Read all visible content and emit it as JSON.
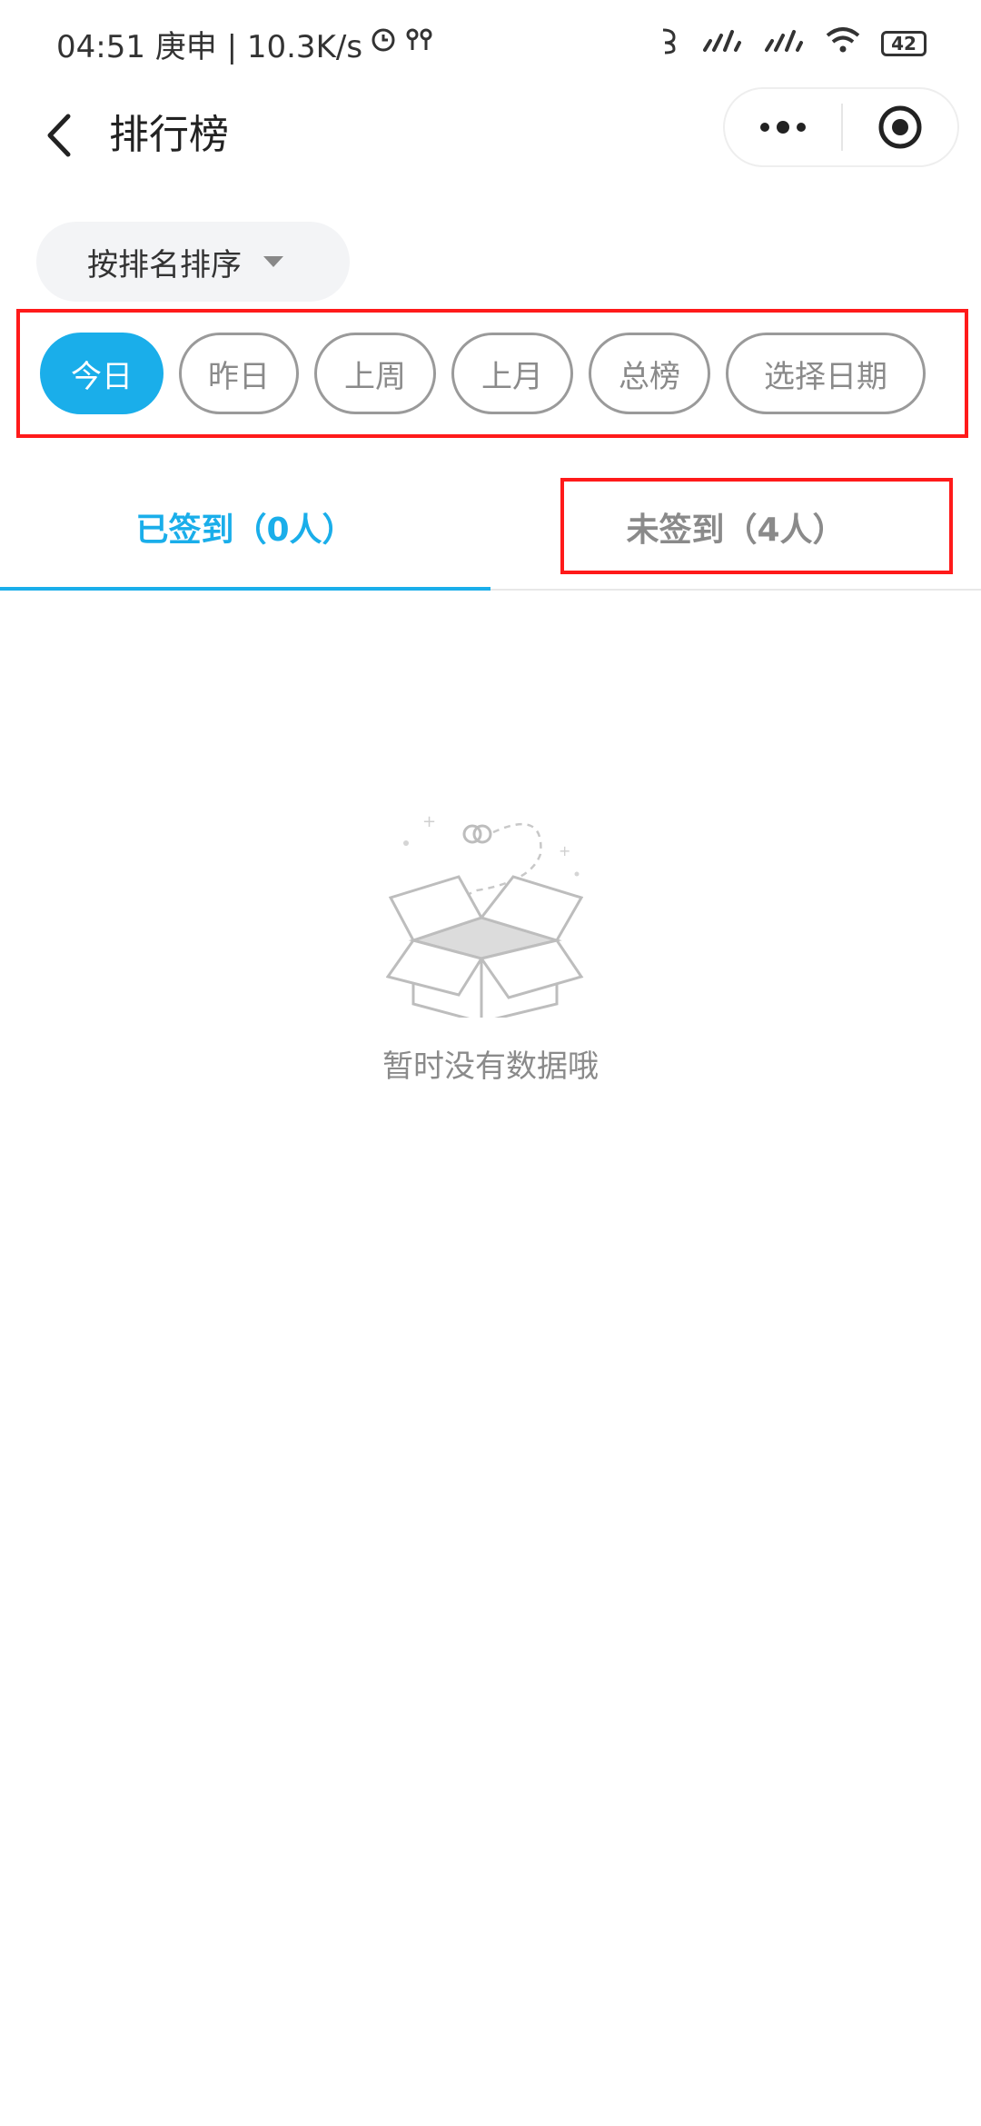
{
  "status_bar": {
    "time_text": "04:51 庚申 | 10.3K/s",
    "battery": "42"
  },
  "nav": {
    "title": "排行榜"
  },
  "sort": {
    "label": "按排名排序"
  },
  "date_filters": [
    {
      "label": "今日",
      "active": true
    },
    {
      "label": "昨日",
      "active": false
    },
    {
      "label": "上周",
      "active": false
    },
    {
      "label": "上月",
      "active": false
    },
    {
      "label": "总榜",
      "active": false
    },
    {
      "label": "选择日期",
      "active": false
    }
  ],
  "tabs": {
    "signed": "已签到（0人）",
    "unsigned": "未签到（4人）",
    "active": "signed"
  },
  "empty_state": {
    "message": "暂时没有数据哦"
  },
  "colors": {
    "accent": "#1aaeea",
    "highlight_box": "#ff1a1a",
    "muted_text": "#8a8a8a"
  }
}
